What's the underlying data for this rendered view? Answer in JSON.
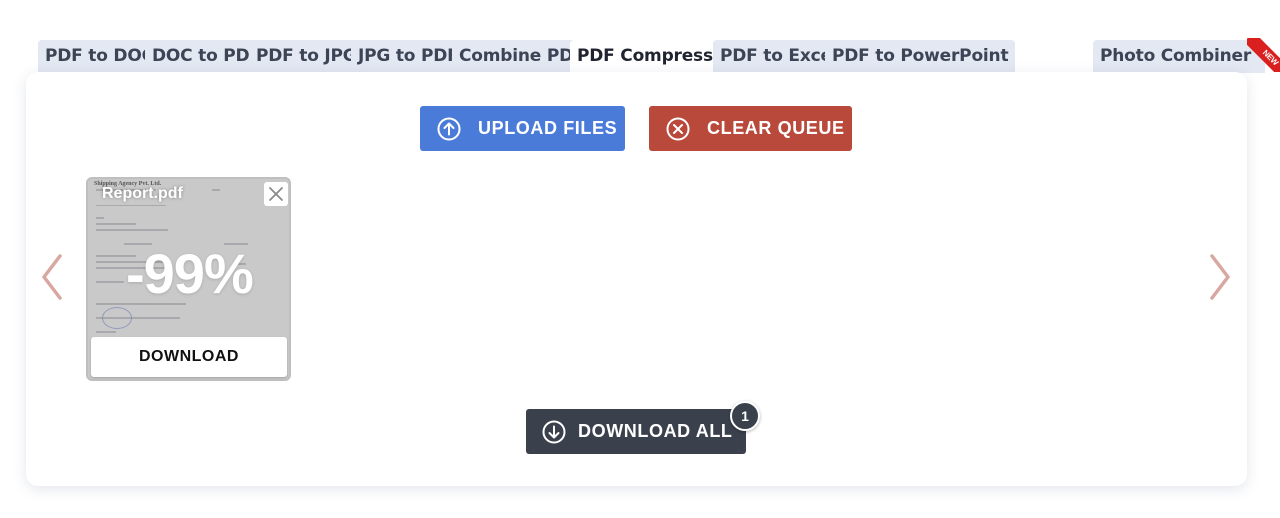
{
  "tabs": [
    {
      "label": "PDF to DOC",
      "active": false
    },
    {
      "label": "DOC to PDF",
      "active": false
    },
    {
      "label": "PDF to JPG",
      "active": false
    },
    {
      "label": "JPG to PDF",
      "active": false
    },
    {
      "label": "Combine PDF",
      "active": false
    },
    {
      "label": "PDF Compressor",
      "active": true
    },
    {
      "label": "PDF to Excel",
      "active": false
    },
    {
      "label": "PDF to PowerPoint",
      "active": false
    },
    {
      "label": "Photo Combiner",
      "active": false,
      "ribbon": "NEW"
    }
  ],
  "toolbar": {
    "upload_label": "UPLOAD FILES",
    "clear_label": "CLEAR QUEUE",
    "upload_icon": "upload-arrow-circle-icon",
    "clear_icon": "close-circle-icon"
  },
  "files": [
    {
      "name": "Report.pdf",
      "reduction": "-99%",
      "download_label": "DOWNLOAD",
      "doc_header": "Shipping Agency Pvt. Ltd."
    }
  ],
  "download_all": {
    "label": "DOWNLOAD ALL",
    "count": "1",
    "icon": "download-arrow-circle-icon"
  },
  "colors": {
    "upload": "#4a7bd8",
    "clear": "#b9493b",
    "download_all": "#3b414c",
    "tab_bg": "#e3e8f2",
    "arrow": "#d8a8a0",
    "ribbon": "#d9201e"
  }
}
